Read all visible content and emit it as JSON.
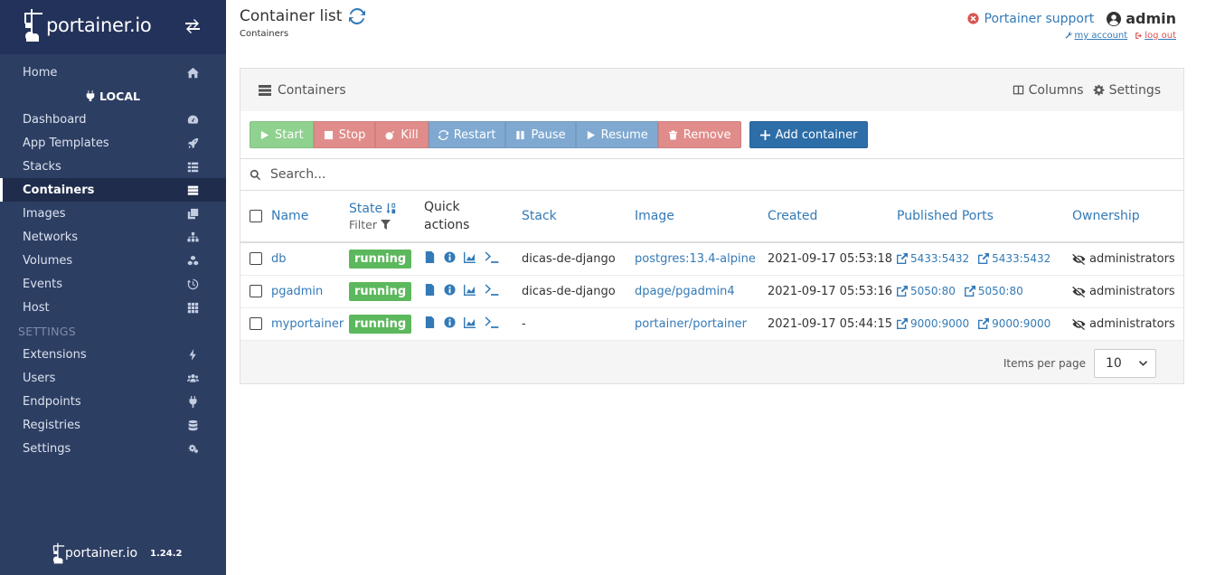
{
  "brand": {
    "logo_text": "portainer.io",
    "version": "1.24.2"
  },
  "sidebar": {
    "home": "Home",
    "endpoint": "LOCAL",
    "items": [
      {
        "label": "Dashboard",
        "icon": "tachometer-icon"
      },
      {
        "label": "App Templates",
        "icon": "rocket-icon"
      },
      {
        "label": "Stacks",
        "icon": "th-list-icon"
      },
      {
        "label": "Containers",
        "icon": "server-icon",
        "active": true
      },
      {
        "label": "Images",
        "icon": "clone-icon"
      },
      {
        "label": "Networks",
        "icon": "sitemap-icon"
      },
      {
        "label": "Volumes",
        "icon": "cubes-icon"
      },
      {
        "label": "Events",
        "icon": "history-icon"
      },
      {
        "label": "Host",
        "icon": "th-icon"
      }
    ],
    "settings_section": "SETTINGS",
    "settings_items": [
      {
        "label": "Extensions",
        "icon": "bolt-icon"
      },
      {
        "label": "Users",
        "icon": "users-icon"
      },
      {
        "label": "Endpoints",
        "icon": "plug-icon"
      },
      {
        "label": "Registries",
        "icon": "database-icon"
      },
      {
        "label": "Settings",
        "icon": "cogs-icon"
      }
    ]
  },
  "header": {
    "title": "Container list",
    "breadcrumb": "Containers",
    "support": "Portainer support",
    "user": "admin",
    "my_account": "my account",
    "log_out": "log out"
  },
  "panel": {
    "title": "Containers",
    "columns_label": "Columns",
    "settings_label": "Settings",
    "buttons": {
      "start": "Start",
      "stop": "Stop",
      "kill": "Kill",
      "restart": "Restart",
      "pause": "Pause",
      "resume": "Resume",
      "remove": "Remove",
      "add": "Add container"
    },
    "search_placeholder": "Search...",
    "columns": {
      "name": "Name",
      "state": "State",
      "filter": "Filter",
      "quick_actions_1": "Quick",
      "quick_actions_2": "actions",
      "stack": "Stack",
      "image": "Image",
      "created": "Created",
      "ports": "Published Ports",
      "ownership": "Ownership"
    },
    "rows": [
      {
        "name": "db",
        "state": "running",
        "stack": "dicas-de-django",
        "image": "postgres:13.4-alpine",
        "created": "2021-09-17 05:53:18",
        "ports": [
          "5433:5432",
          "5433:5432"
        ],
        "ownership": "administrators"
      },
      {
        "name": "pgadmin",
        "state": "running",
        "stack": "dicas-de-django",
        "image": "dpage/pgadmin4",
        "created": "2021-09-17 05:53:16",
        "ports": [
          "5050:80",
          "5050:80"
        ],
        "ownership": "administrators"
      },
      {
        "name": "myportainer",
        "state": "running",
        "stack": "-",
        "image": "portainer/portainer",
        "created": "2021-09-17 05:44:15",
        "ports": [
          "9000:9000",
          "9000:9000"
        ],
        "ownership": "administrators"
      }
    ],
    "items_per_page_label": "Items per page",
    "items_per_page_value": "10"
  }
}
